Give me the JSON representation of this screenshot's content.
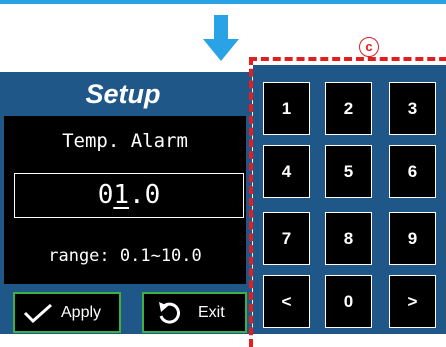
{
  "callout": "c",
  "setup": {
    "title": "Setup",
    "alarm_label": "Temp. Alarm",
    "value_prefix": "0",
    "value_cursor": "1",
    "value_suffix": ".0",
    "range_label": "range: 0.1~10.0"
  },
  "buttons": {
    "apply": {
      "label": "Apply",
      "icon": "check-icon"
    },
    "exit": {
      "label": "Exit",
      "icon": "undo-icon"
    }
  },
  "keypad": {
    "keys": [
      "1",
      "2",
      "3",
      "4",
      "5",
      "6",
      "7",
      "8",
      "9",
      "<",
      "0",
      ">"
    ]
  },
  "colors": {
    "panel_blue": "#1e5788",
    "accent_blue": "#2aa3e6",
    "callout_red": "#e02020",
    "button_border_green": "#3cb043"
  }
}
